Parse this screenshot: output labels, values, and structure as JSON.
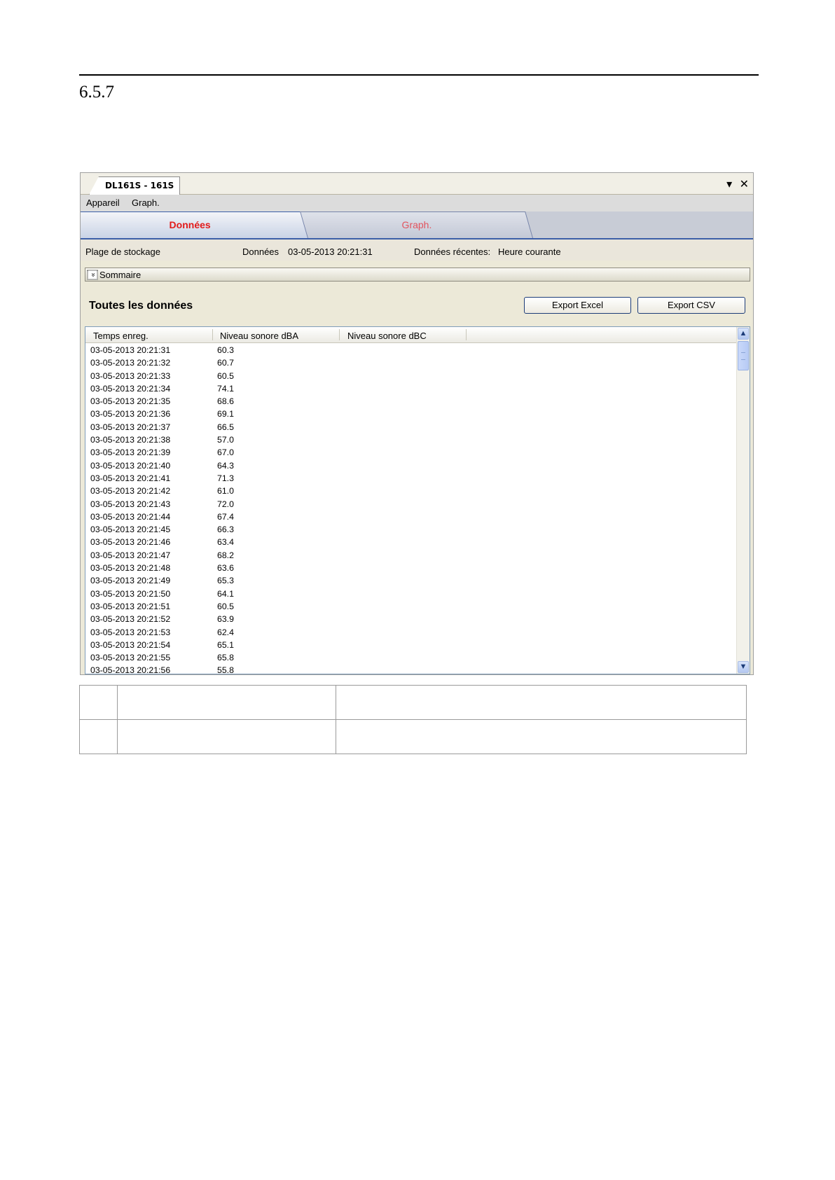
{
  "document": {
    "section_number": "6.5.7"
  },
  "window": {
    "doc_tab": "DL161S - 161S",
    "controls": {
      "dropdown": "▾",
      "close": "✕"
    }
  },
  "menu": [
    "Appareil",
    "Graph."
  ],
  "tabs": [
    {
      "label": "Données",
      "active": true,
      "color": "#e21b1b"
    },
    {
      "label": "Graph.",
      "active": false,
      "color": "#e2545e"
    }
  ],
  "info": {
    "storage_label": "Plage de stockage",
    "data_label": "Données",
    "data_value": "03-05-2013 20:21:31",
    "recent_label": "Données récentes:",
    "recent_value": "Heure courante"
  },
  "summary": {
    "label": "Sommaire"
  },
  "section": {
    "title": "Toutes les données",
    "export_excel": "Export Excel",
    "export_csv": "Export CSV"
  },
  "table": {
    "columns": [
      "Temps enreg.",
      "Niveau sonore dBA",
      "Niveau sonore dBC"
    ],
    "rows": [
      [
        "03-05-2013 20:21:31",
        "60.3",
        ""
      ],
      [
        "03-05-2013 20:21:32",
        "60.7",
        ""
      ],
      [
        "03-05-2013 20:21:33",
        "60.5",
        ""
      ],
      [
        "03-05-2013 20:21:34",
        "74.1",
        ""
      ],
      [
        "03-05-2013 20:21:35",
        "68.6",
        ""
      ],
      [
        "03-05-2013 20:21:36",
        "69.1",
        ""
      ],
      [
        "03-05-2013 20:21:37",
        "66.5",
        ""
      ],
      [
        "03-05-2013 20:21:38",
        "57.0",
        ""
      ],
      [
        "03-05-2013 20:21:39",
        "67.0",
        ""
      ],
      [
        "03-05-2013 20:21:40",
        "64.3",
        ""
      ],
      [
        "03-05-2013 20:21:41",
        "71.3",
        ""
      ],
      [
        "03-05-2013 20:21:42",
        "61.0",
        ""
      ],
      [
        "03-05-2013 20:21:43",
        "72.0",
        ""
      ],
      [
        "03-05-2013 20:21:44",
        "67.4",
        ""
      ],
      [
        "03-05-2013 20:21:45",
        "66.3",
        ""
      ],
      [
        "03-05-2013 20:21:46",
        "63.4",
        ""
      ],
      [
        "03-05-2013 20:21:47",
        "68.2",
        ""
      ],
      [
        "03-05-2013 20:21:48",
        "63.6",
        ""
      ],
      [
        "03-05-2013 20:21:49",
        "65.3",
        ""
      ],
      [
        "03-05-2013 20:21:50",
        "64.1",
        ""
      ],
      [
        "03-05-2013 20:21:51",
        "60.5",
        ""
      ],
      [
        "03-05-2013 20:21:52",
        "63.9",
        ""
      ],
      [
        "03-05-2013 20:21:53",
        "62.4",
        ""
      ],
      [
        "03-05-2013 20:21:54",
        "65.1",
        ""
      ],
      [
        "03-05-2013 20:21:55",
        "65.8",
        ""
      ],
      [
        "03-05-2013 20:21:56",
        "55.8",
        ""
      ]
    ]
  },
  "scrollbar": {
    "up": "▲",
    "down": "▼"
  },
  "summary_icon": "»"
}
